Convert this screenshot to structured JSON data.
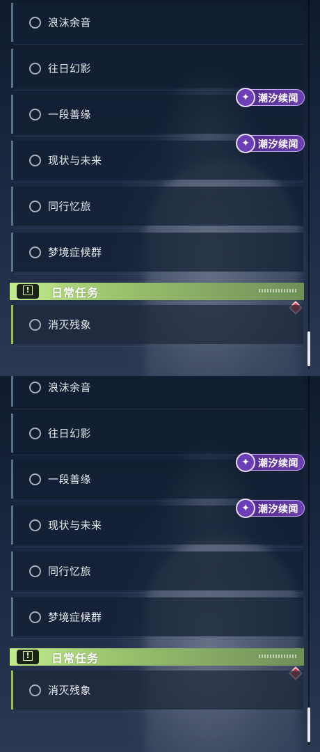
{
  "quests": [
    {
      "label": "浪沫余音"
    },
    {
      "label": "往日幻影"
    },
    {
      "label": "一段善缘"
    },
    {
      "label": "现状与未来"
    },
    {
      "label": "同行忆旅"
    },
    {
      "label": "梦境症候群"
    }
  ],
  "badges": [
    {
      "text": "潮汐续闻"
    },
    {
      "text": "潮汐续闻"
    }
  ],
  "daily_section": {
    "title": "日常任务",
    "icon": "exclamation-icon",
    "items": [
      {
        "label": "消灭残象"
      }
    ]
  },
  "colors": {
    "daily_accent": "#c4ec8f",
    "badge_purple": "#6b3fb0",
    "tracked_marker": "#d23b4b"
  }
}
